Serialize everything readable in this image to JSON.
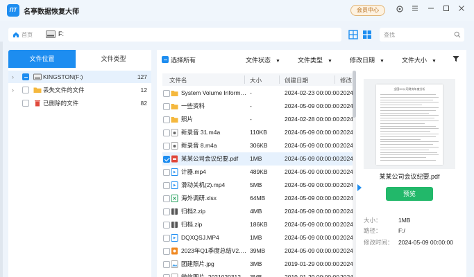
{
  "app": {
    "logo_text": "ΠT",
    "title": "名亭数据恢复大师",
    "member_label": "会员中心"
  },
  "address": {
    "home_label": "首页",
    "path": "F:"
  },
  "search": {
    "placeholder": "查找"
  },
  "left_tabs": [
    "文件位置",
    "文件类型"
  ],
  "tree": [
    {
      "label": "KINGSTON(F:)",
      "count": "127",
      "expandable": true,
      "checkbox": "partial",
      "selected": true,
      "icon": "drive-icon"
    },
    {
      "label": "丢失文件的文件",
      "count": "12",
      "expandable": true,
      "checkbox": "none",
      "selected": false,
      "icon": "folder-icon"
    },
    {
      "label": "已删除的文件",
      "count": "82",
      "expandable": false,
      "checkbox": "none",
      "selected": false,
      "icon": "trash-icon"
    }
  ],
  "toolbar": {
    "select_all": "选择所有",
    "filters": [
      "文件状态",
      "文件类型",
      "修改日期",
      "文件大小"
    ]
  },
  "table": {
    "headers": [
      "文件名",
      "大小",
      "创建日期",
      "修改"
    ],
    "rows": [
      {
        "name": "System Volume Informa...",
        "size": "-",
        "created": "2024-02-23 00:00:00",
        "modified": "2024",
        "icon": "folder-icon",
        "checked": false
      },
      {
        "name": "一些资料",
        "size": "-",
        "created": "2024-05-09 00:00:00",
        "modified": "2024",
        "icon": "folder-icon",
        "checked": false
      },
      {
        "name": "照片",
        "size": "-",
        "created": "2024-02-28 00:00:00",
        "modified": "2024",
        "icon": "folder-icon",
        "checked": false
      },
      {
        "name": "新录音 31.m4a",
        "size": "110KB",
        "created": "2024-05-09 00:00:00",
        "modified": "2024",
        "icon": "audio-icon",
        "checked": false
      },
      {
        "name": "新录音 8.m4a",
        "size": "306KB",
        "created": "2024-05-09 00:00:00",
        "modified": "2024",
        "icon": "audio-icon",
        "checked": false
      },
      {
        "name": "某某公司会议纪要.pdf",
        "size": "1MB",
        "created": "2024-05-09 00:00:00",
        "modified": "2024",
        "icon": "pdf-icon",
        "checked": true
      },
      {
        "name": "计器.mp4",
        "size": "489KB",
        "created": "2024-05-09 00:00:00",
        "modified": "2024",
        "icon": "video-icon",
        "checked": false
      },
      {
        "name": "滑动关机(2).mp4",
        "size": "5MB",
        "created": "2024-05-09 00:00:00",
        "modified": "2024",
        "icon": "video-icon",
        "checked": false
      },
      {
        "name": "海外调研.xlsx",
        "size": "64MB",
        "created": "2024-05-09 00:00:00",
        "modified": "2024",
        "icon": "excel-icon",
        "checked": false
      },
      {
        "name": "归档2.zip",
        "size": "4MB",
        "created": "2024-05-09 00:00:00",
        "modified": "2024",
        "icon": "zip-icon",
        "checked": false
      },
      {
        "name": "归档.zip",
        "size": "186KB",
        "created": "2024-05-09 00:00:00",
        "modified": "2024",
        "icon": "zip-icon",
        "checked": false
      },
      {
        "name": "DQXQSJ.MP4",
        "size": "1MB",
        "created": "2024-05-09 00:00:00",
        "modified": "2024",
        "icon": "video-icon",
        "checked": false
      },
      {
        "name": "2023年Q1季度总结V2.pptx",
        "size": "39MB",
        "created": "2024-05-09 00:00:00",
        "modified": "2024",
        "icon": "ppt-icon",
        "checked": false
      },
      {
        "name": "团建照片.jpg",
        "size": "3MB",
        "created": "2019-01-29 00:00:00",
        "modified": "2024",
        "icon": "image-icon",
        "checked": false
      },
      {
        "name": "微信图片_20210203120...",
        "size": "3MB",
        "created": "2019-01-29 00:00:00",
        "modified": "2024",
        "icon": "image-icon",
        "checked": false
      }
    ]
  },
  "preview": {
    "doc_title": "全国XX公司财务年度分析",
    "file_name": "某某公司会议纪要.pdf",
    "button": "预览",
    "size_label": "大小：",
    "size_value": "1MB",
    "path_label": "路径：",
    "path_value": "F:/",
    "modified_label": "修改时间：",
    "modified_value": "2024-05-09 00:00:00"
  },
  "colors": {
    "accent": "#1d8df0",
    "preview_button": "#22b86a",
    "member_text": "#b56b1a"
  }
}
